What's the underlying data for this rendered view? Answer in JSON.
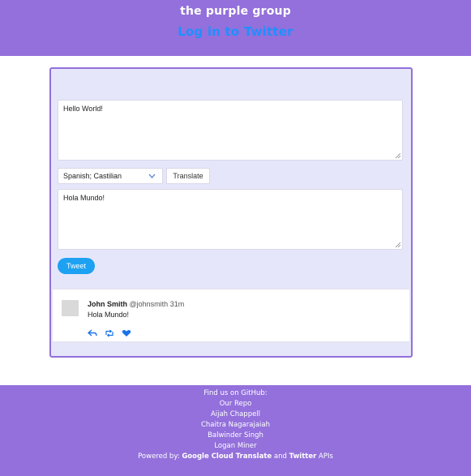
{
  "header": {
    "brand": "the purple group",
    "login_link": "Log in to Twitter"
  },
  "composer": {
    "input_text": "Hello World!",
    "language_selected": "Spanish; Castilian",
    "translate_label": "Translate",
    "output_text": "Hola Mundo!",
    "tweet_label": "Tweet"
  },
  "tweet": {
    "name": "John Smith",
    "handle": "@johnsmith",
    "time": "31m",
    "text": "Hola Mundo!",
    "icons": [
      "reply-icon",
      "retweet-icon",
      "like-icon"
    ]
  },
  "footer": {
    "find_us": "Find us on GitHub:",
    "links": [
      "Our Repo",
      "Aijah Chappell",
      "Chaitra Nagarajaiah",
      "Balwinder Singh",
      "Logan Miner"
    ],
    "powered_prefix": "Powered by:",
    "powered_google": "Google Cloud Translate",
    "powered_and": "and",
    "powered_twitter": "Twitter",
    "powered_suffix": "APIs"
  },
  "colors": {
    "brand_purple": "#9370DB",
    "panel_lavender": "#E6E6FA",
    "link_blue": "#1E90FF",
    "tweet_blue": "#1DA1F2"
  }
}
